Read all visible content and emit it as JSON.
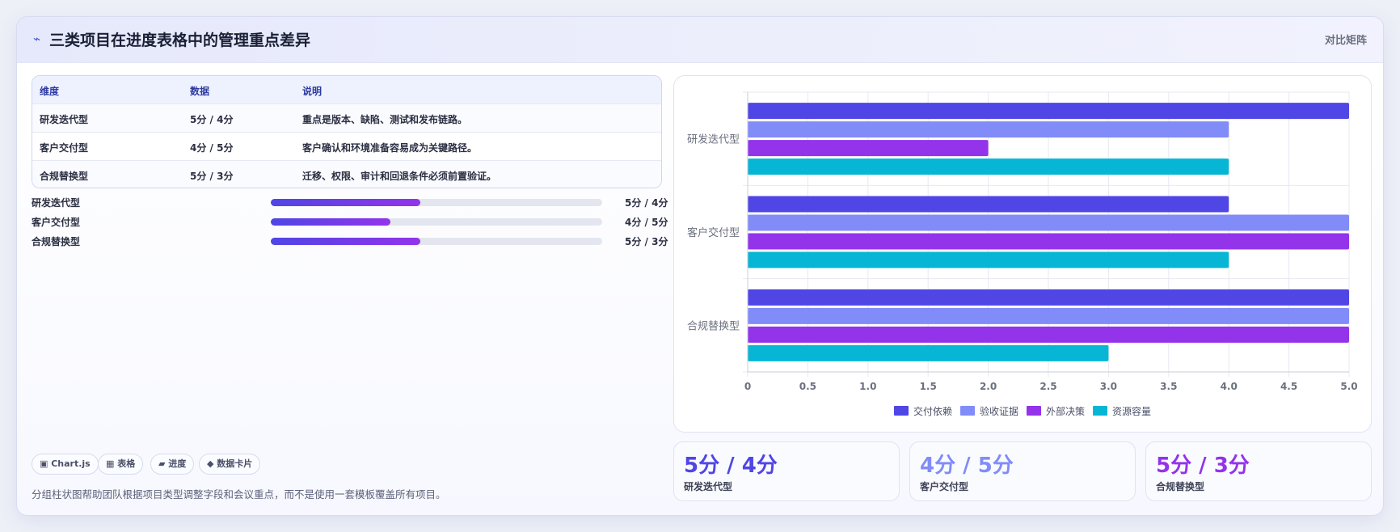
{
  "header": {
    "icon": "bolt-icon",
    "title": "三类项目在进度表格中的管理重点差异",
    "tag": "对比矩阵"
  },
  "table": {
    "headers": [
      "维度",
      "数据",
      "说明"
    ],
    "rows": [
      [
        "研发迭代型",
        "5分 / 4分",
        "重点是版本、缺陷、测试和发布链路。"
      ],
      [
        "客户交付型",
        "4分 / 5分",
        "客户确认和环境准备容易成为关键路径。"
      ],
      [
        "合规替换型",
        "5分 / 3分",
        "迁移、权限、审计和回退条件必须前置验证。"
      ]
    ]
  },
  "progress": [
    {
      "label": "研发迭代型",
      "value": "5分 / 4分",
      "fraction": 0.45
    },
    {
      "label": "客户交付型",
      "value": "4分 / 5分",
      "fraction": 0.36
    },
    {
      "label": "合规替换型",
      "value": "5分 / 3分",
      "fraction": 0.45
    }
  ],
  "chips": [
    "▣ Chart.js",
    "▦ 表格",
    "▰ 进度",
    "◆ 数据卡片"
  ],
  "footnote": "分组柱状图帮助团队根据项目类型调整字段和会议重点，而不是使用一套模板覆盖所有项目。",
  "kpis": [
    {
      "value": "5分 / 4分",
      "label": "研发迭代型",
      "color": "#4f46e5"
    },
    {
      "value": "4分 / 5分",
      "label": "客户交付型",
      "color": "#818cf8"
    },
    {
      "value": "5分 / 3分",
      "label": "合规替换型",
      "color": "#9333ea"
    }
  ],
  "chart_data": {
    "type": "bar",
    "orientation": "horizontal",
    "categories": [
      "研发迭代型",
      "客户交付型",
      "合规替换型"
    ],
    "series": [
      {
        "name": "交付依赖",
        "values": [
          5,
          4,
          5
        ],
        "color": "#4f46e5"
      },
      {
        "name": "验收证据",
        "values": [
          4,
          5,
          5
        ],
        "color": "#818cf8"
      },
      {
        "name": "外部决策",
        "values": [
          2,
          5,
          5
        ],
        "color": "#9333ea"
      },
      {
        "name": "资源容量",
        "values": [
          4,
          4,
          3
        ],
        "color": "#06b6d4"
      }
    ],
    "xlim": [
      0,
      5
    ],
    "xticks": [
      "0",
      "0.5",
      "1.0",
      "1.5",
      "2.0",
      "2.5",
      "3.0",
      "3.5",
      "4.0",
      "4.5",
      "5.0"
    ],
    "grid": true,
    "legend": "bottom"
  }
}
